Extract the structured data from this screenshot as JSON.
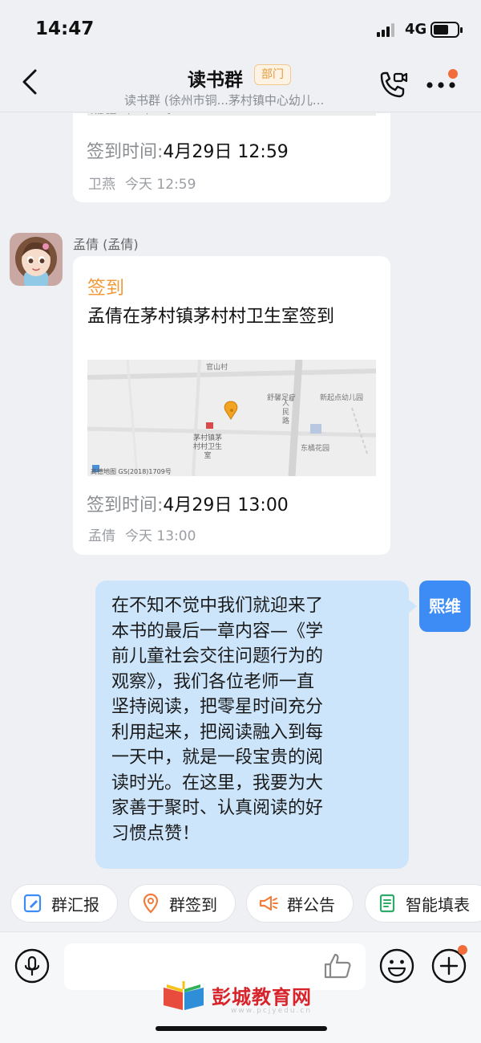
{
  "status_bar": {
    "time": "14:47",
    "network": "4G"
  },
  "header": {
    "title": "读书群",
    "badge": "部门",
    "subtitle": "读书群 (徐州市铜...茅村镇中心幼儿..."
  },
  "map_credit": "高德地图 GS(2018)1709号",
  "messages": [
    {
      "type": "signin",
      "partial": true,
      "time_label": "签到时间:",
      "time_value": "4月29日 12:59",
      "meta_name": "卫燕",
      "meta_time": "今天 12:59"
    },
    {
      "type": "signin",
      "sender": "孟倩 (孟倩)",
      "heading": "签到",
      "body": "孟倩在茅村镇茅村村卫生室签到",
      "map_labels": [
        "官山村",
        "舒馨足疗",
        "新起点幼儿园",
        "人民路",
        "茅村镇茅村村卫生室",
        "东橘花园"
      ],
      "time_label": "签到时间:",
      "time_value": "4月29日 13:00",
      "meta_name": "孟倩",
      "meta_time": "今天 13:00"
    },
    {
      "type": "text",
      "self": true,
      "sender_avatar": "熙维",
      "lines": [
        "在不知不觉中我们就迎来了",
        "本书的最后一章内容—《学",
        "前儿童社会交往问题行为的",
        "观察》，我们各位老师一直",
        "坚持阅读，把零星时间充分",
        "利用起来，把阅读融入到每",
        "一天中，就是一段宝贵的阅",
        "读时光。在这里，我要为大",
        "家善于聚时、认真阅读的好",
        "习惯点赞！"
      ]
    }
  ],
  "quick_actions": [
    {
      "label": "群汇报",
      "icon": "report-icon"
    },
    {
      "label": "群签到",
      "icon": "location-pin-icon"
    },
    {
      "label": "群公告",
      "icon": "megaphone-icon"
    },
    {
      "label": "智能填表",
      "icon": "form-icon"
    }
  ],
  "watermark": {
    "text": "彭城教育网",
    "url": "www.pcjyedu.cn"
  },
  "colors": {
    "accent_orange": "#f09a3a",
    "bubble_blue": "#cde5fb",
    "avatar_blue": "#3d8cf6",
    "notify_dot": "#f26b3a",
    "watermark_red": "#d8232a"
  }
}
